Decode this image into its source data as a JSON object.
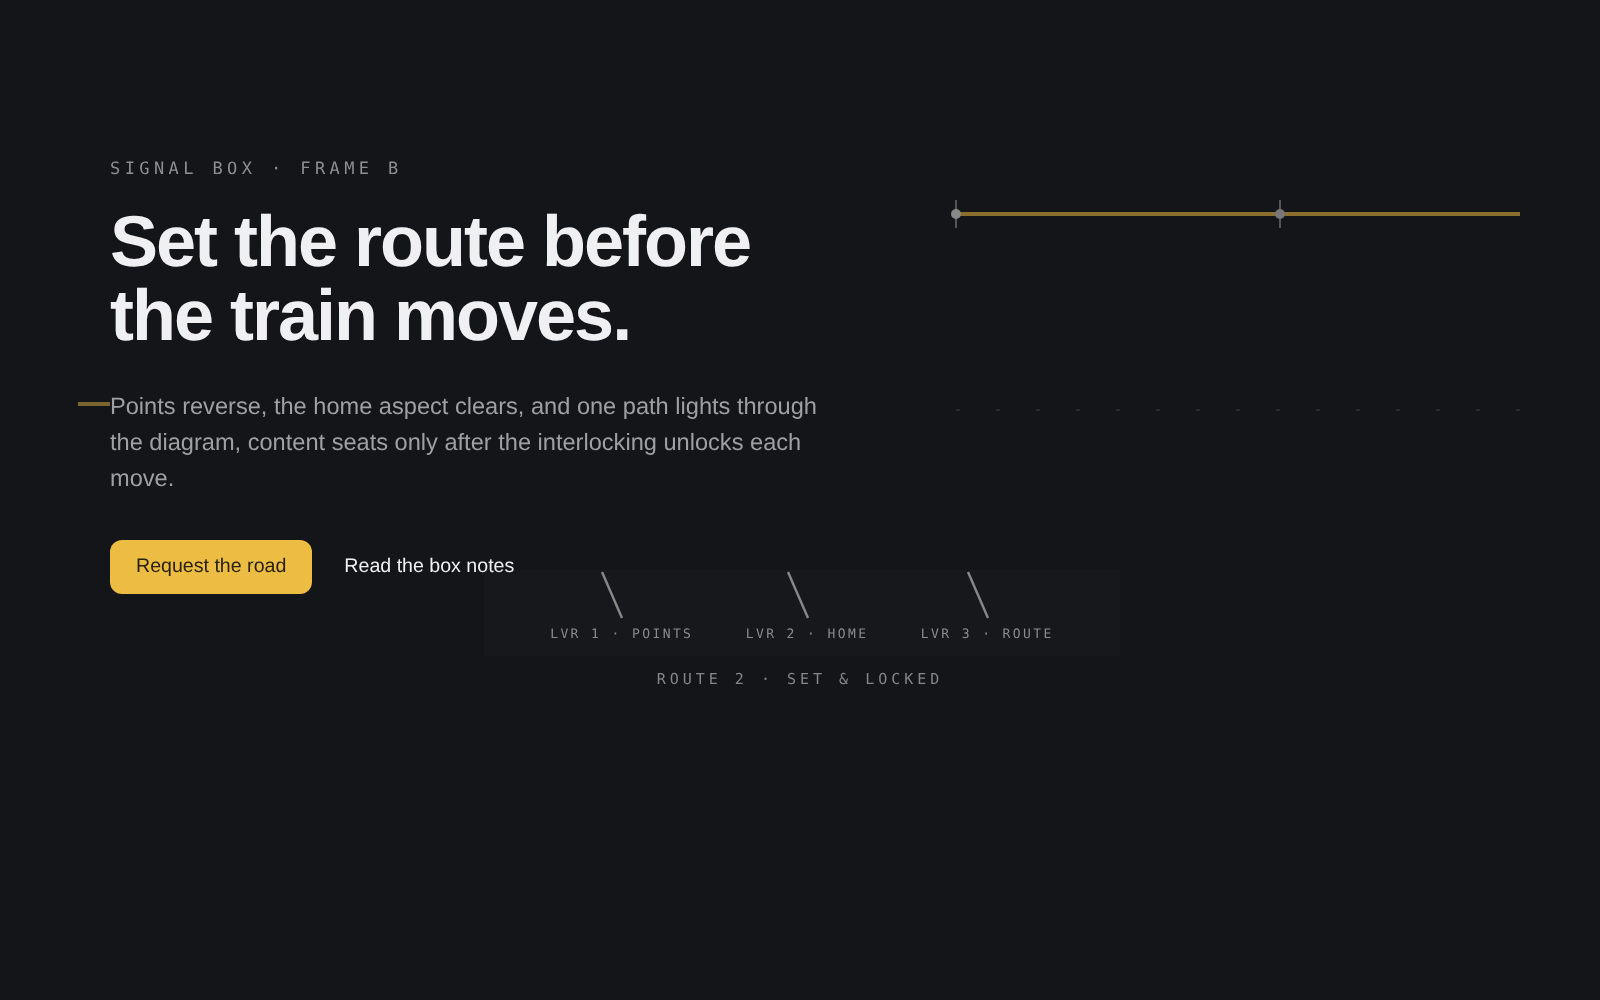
{
  "eyebrow": "SIGNAL BOX · FRAME B",
  "heading": [
    "Set the route before",
    "the train moves."
  ],
  "lede": "Points reverse, the home aspect clears, and one path lights through the diagram, content seats only after the interlocking unlocks each move.",
  "buttons": [
    {
      "kind": "primary",
      "label": "Request the road"
    },
    {
      "kind": "link",
      "label": "Read the box notes"
    }
  ],
  "levers": [
    {
      "label": "LVR 1 · POINTS"
    },
    {
      "label": "LVR 2 · HOME"
    },
    {
      "label": "LVR 3 · ROUTE"
    }
  ],
  "route_status": "ROUTE 2 · SET & LOCKED"
}
